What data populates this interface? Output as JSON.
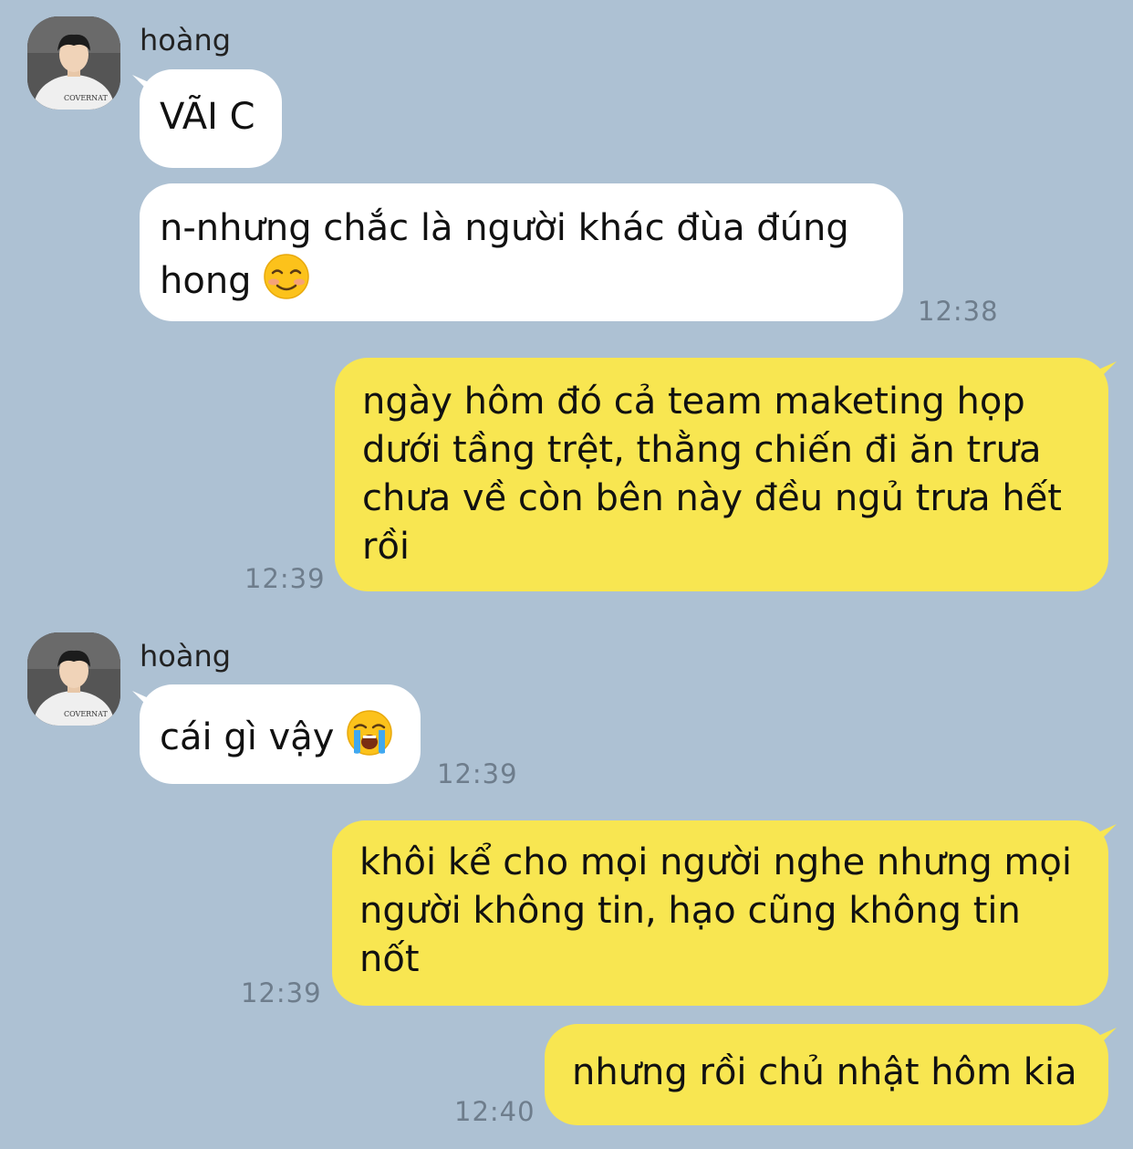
{
  "messages": [
    {
      "sender": "hoàng",
      "text": "VÃI C"
    },
    {
      "text": "n-nhưng chắc là người khác đùa đúng hong",
      "emoji": "smiling-face-icon",
      "time": "12:38"
    },
    {
      "text": "ngày hôm đó cả team maketing họp dưới tầng trệt, thằng chiến đi ăn trưa chưa về còn bên này đều ngủ trưa hết rồi",
      "time": "12:39"
    },
    {
      "sender": "hoàng",
      "text": "cái gì vậy",
      "emoji": "loudly-crying-face-icon",
      "time": "12:39"
    },
    {
      "text": "khôi kể cho mọi người nghe nhưng mọi người không tin, hạo cũng không tin nốt",
      "time": "12:39"
    },
    {
      "text": "nhưng rồi chủ nhật hôm kia",
      "time": "12:40"
    }
  ],
  "colors": {
    "background": "#adc1d3",
    "incoming_bubble": "#ffffff",
    "outgoing_bubble": "#f8e651",
    "timestamp": "#6e7d8c"
  }
}
